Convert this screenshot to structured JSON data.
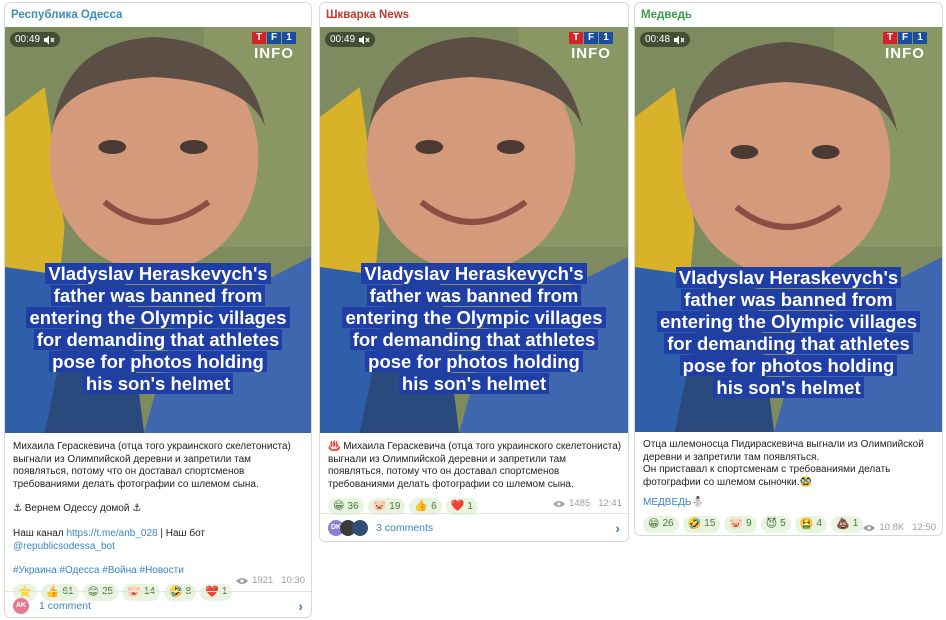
{
  "posts": [
    {
      "channel": "Республика Одесса",
      "channel_color": "#3a8fb5",
      "time": "00:49",
      "logo_top": "TF1",
      "logo_bottom": "INFO",
      "caption": [
        "Vladyslav Heraskevych's",
        "father was banned from",
        "entering the Olympic villages",
        "for demanding that athletes",
        "pose for photos holding",
        "his son's helmet"
      ],
      "text": "Михаила Гераскевича (отца того украинского скелетониста) выгнали из Олимпийской деревни и запретили там появляться, потому что он доставал спортсменов требованиями делать фотографии со шлемом сына.",
      "line2": "⚓ Вернем Одессу домой ⚓",
      "line3_prefix": "Наш канал ",
      "line3_link1": "https://t.me/anb_028",
      "line3_mid": " | Наш бот ",
      "line3_link2": "@republicsodessa_bot",
      "hashtags": "#Украина #Одесса #Война #Новости",
      "reactions": [
        {
          "icon": "⭐",
          "count": ""
        },
        {
          "icon": "👍",
          "count": "61"
        },
        {
          "icon": "😁",
          "count": "25"
        },
        {
          "icon": "🐷",
          "count": "14"
        },
        {
          "icon": "🤣",
          "count": "8"
        },
        {
          "icon": "❤️",
          "count": "1"
        }
      ],
      "views": "1921",
      "posted": "10:30",
      "comment_avatar": "AK",
      "comments": "1 comment"
    },
    {
      "channel": "Шкварка News",
      "channel_color": "#c0392b",
      "time": "00:49",
      "logo_top": "TF1",
      "logo_bottom": "INFO",
      "caption": [
        "Vladyslav Heraskevych's",
        "father was banned from",
        "entering the Olympic villages",
        "for demanding that athletes",
        "pose for photos holding",
        "his son's helmet"
      ],
      "text": "♨️ Михаила Гераскевича (отца того украинского скелетониста) выгнали из Олимпийской деревни и запретили там появляться, потому что он доставал спортсменов требованиями делать фотографии со шлемом сына.",
      "reactions": [
        {
          "icon": "😁",
          "count": "36"
        },
        {
          "icon": "🐷",
          "count": "19"
        },
        {
          "icon": "👍",
          "count": "6"
        },
        {
          "icon": "❤️",
          "count": "1"
        }
      ],
      "views": "1485",
      "posted": "12:41",
      "comment_avatar": "DK",
      "comments": "3 comments"
    },
    {
      "channel": "Медведь",
      "channel_color": "#3d9a4a",
      "time": "00:48",
      "logo_top": "TF1",
      "logo_bottom": "INFO",
      "caption": [
        "Vladyslav Heraskevych's",
        "father was banned from",
        "entering the Olympic villages",
        "for demanding that athletes",
        "pose for photos holding",
        "his son's helmet"
      ],
      "text": "Отца шлемоносца Пидираскевича выгнали из Олимпийской деревни и запретили там появляться.",
      "line2": " Он приставал к  спортсменам с требованиями делать фотографии со шлемом  сыночки.🥸",
      "signature": "МЕДВЕДЬ⛄",
      "reactions": [
        {
          "icon": "😁",
          "count": "26"
        },
        {
          "icon": "🤣",
          "count": "15"
        },
        {
          "icon": "🐷",
          "count": "9"
        },
        {
          "icon": "😈",
          "count": "5"
        },
        {
          "icon": "🤮",
          "count": "4"
        },
        {
          "icon": "💩",
          "count": "1"
        }
      ],
      "views": "10.8K",
      "posted": "12:50"
    }
  ]
}
